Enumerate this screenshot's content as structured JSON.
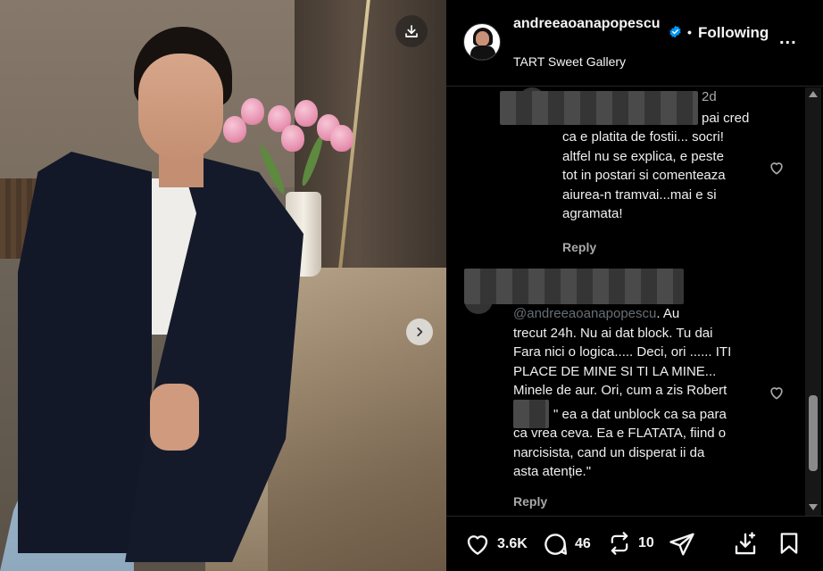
{
  "post": {
    "username": "andreeaoanapopescu",
    "follow_status": "Following",
    "separator": "•",
    "more_label": "...",
    "location": "TART Sweet Gallery"
  },
  "comments": [
    {
      "age": "2d",
      "text": "pai cred ca e platita de fostii... socri! altfel nu se explica, e peste tot in postari si comenteaza aiurea-n tramvai...mai e si agramata!",
      "lines": [
        "pai cred",
        "ca e platita de fostii... socri!",
        "altfel nu se explica, e peste",
        "tot in postari si comenteaza",
        "aiurea-n tramvai...mai e si",
        "agramata!"
      ],
      "reply_label": "Reply"
    },
    {
      "mention": "@andreeaoanapopescu",
      "lines": [
        ". Au",
        "trecut 24h. Nu ai dat block. Tu dai",
        "Fara nici o logica..... Deci, ori ...... ITI",
        "PLACE DE MINE SI TI LA MINE...",
        "Minele de aur. Ori, cum a zis Robert",
        "\" ea a dat unblock ca sa para",
        "ca vrea ceva. Ea e FLATATA, fiind o",
        "narcisista, cand un disperat ii da",
        "asta atenție.\""
      ],
      "reply_label": "Reply"
    }
  ],
  "actions": {
    "likes": "3.6K",
    "comments": "46",
    "reposts": "10"
  },
  "colors": {
    "background": "#000000",
    "text": "#f5f5f5",
    "muted": "#a8a8a8",
    "verified": "#0095f6"
  },
  "icons": [
    "download-icon",
    "chevron-right-icon",
    "verified-badge-icon",
    "heart-icon",
    "comment-icon",
    "repost-icon",
    "share-icon",
    "save-post-icon",
    "bookmark-icon"
  ]
}
